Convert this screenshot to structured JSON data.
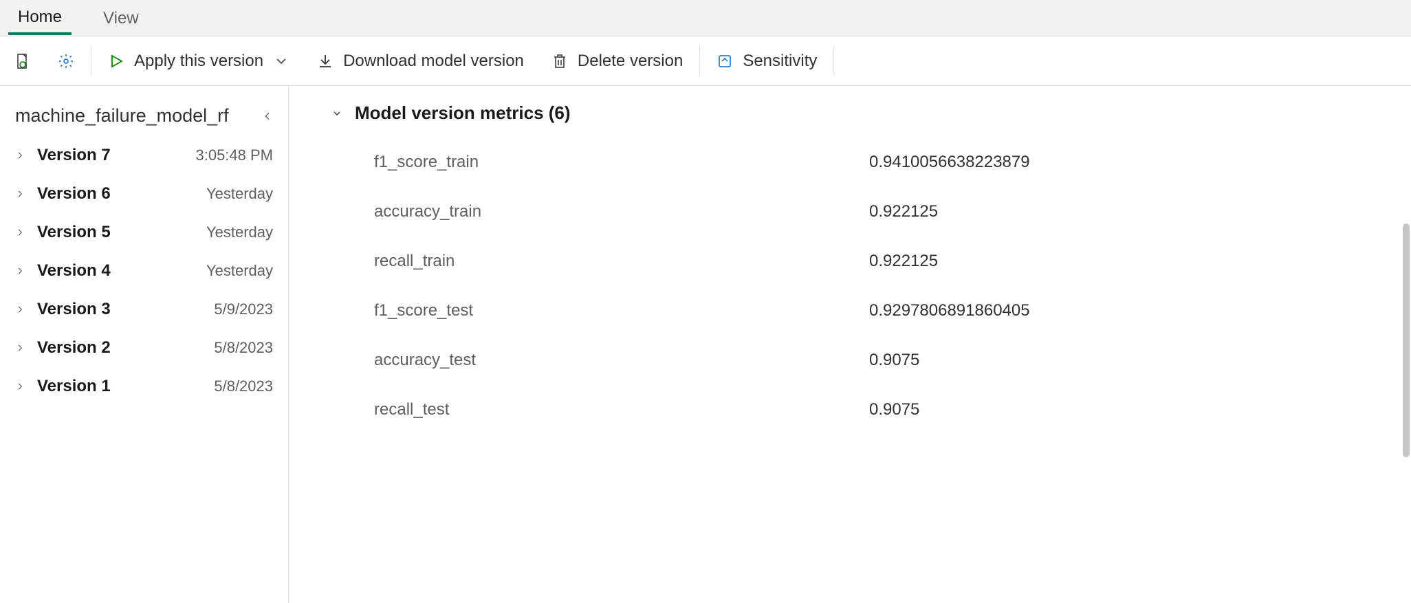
{
  "tabs": {
    "home": "Home",
    "view": "View"
  },
  "toolbar": {
    "apply": "Apply this version",
    "download": "Download model version",
    "delete": "Delete version",
    "sensitivity": "Sensitivity"
  },
  "sidebar": {
    "title": "machine_failure_model_rf",
    "items": [
      {
        "name": "Version 7",
        "time": "3:05:48 PM"
      },
      {
        "name": "Version 6",
        "time": "Yesterday"
      },
      {
        "name": "Version 5",
        "time": "Yesterday"
      },
      {
        "name": "Version 4",
        "time": "Yesterday"
      },
      {
        "name": "Version 3",
        "time": "5/9/2023"
      },
      {
        "name": "Version 2",
        "time": "5/8/2023"
      },
      {
        "name": "Version 1",
        "time": "5/8/2023"
      }
    ]
  },
  "detail": {
    "header": "Model version metrics (6)",
    "metrics": [
      {
        "name": "f1_score_train",
        "value": "0.9410056638223879"
      },
      {
        "name": "accuracy_train",
        "value": "0.922125"
      },
      {
        "name": "recall_train",
        "value": "0.922125"
      },
      {
        "name": "f1_score_test",
        "value": "0.9297806891860405"
      },
      {
        "name": "accuracy_test",
        "value": "0.9075"
      },
      {
        "name": "recall_test",
        "value": "0.9075"
      }
    ]
  }
}
